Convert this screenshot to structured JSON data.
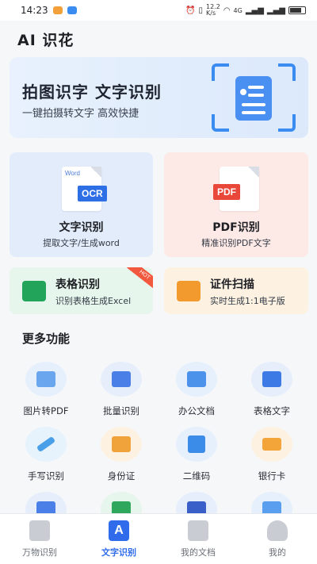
{
  "status_bar": {
    "time": "14:23",
    "net_speed": "12.2\nK/s",
    "signal": "4G",
    "battery": ""
  },
  "app": {
    "title": "AI 识花"
  },
  "banner": {
    "title": "拍图识字  文字识别",
    "subtitle": "一键拍摄转文字  高效快捷"
  },
  "cards": {
    "ocr": {
      "icon_word": "Word",
      "icon_tag": "OCR",
      "title": "文字识别",
      "subtitle": "提取文字/生成word"
    },
    "pdf": {
      "icon_tag": "PDF",
      "title": "PDF识别",
      "subtitle": "精准识别PDF文字"
    },
    "table": {
      "title": "表格识别",
      "subtitle": "识别表格生成Excel",
      "badge": "HOT"
    },
    "id": {
      "title": "证件扫描",
      "subtitle": "实时生成1:1电子版"
    }
  },
  "more": {
    "title": "更多功能",
    "items": [
      {
        "label": "图片转PDF",
        "icon": "image-pdf-icon",
        "color": "#6aa6ee"
      },
      {
        "label": "批量识别",
        "icon": "batch-scan-icon",
        "color": "#4a7fe8"
      },
      {
        "label": "办公文档",
        "icon": "office-doc-icon",
        "color": "#4d92ea"
      },
      {
        "label": "表格文字",
        "icon": "table-text-icon",
        "color": "#3d7ae6"
      },
      {
        "label": "手写识别",
        "icon": "pen-icon",
        "color": "#4aa0e8"
      },
      {
        "label": "身份证",
        "icon": "id-card-icon",
        "color": "#f0a33a"
      },
      {
        "label": "二维码",
        "icon": "qr-code-icon",
        "color": "#3b8be8"
      },
      {
        "label": "银行卡",
        "icon": "bank-card-icon",
        "color": "#f3a53a"
      }
    ]
  },
  "tabs": [
    {
      "label": "万物识别",
      "icon": "image-icon",
      "active": false
    },
    {
      "label": "文字识别",
      "icon": "text-a-icon",
      "active": true,
      "glyph": "A"
    },
    {
      "label": "我的文档",
      "icon": "document-icon",
      "active": false
    },
    {
      "label": "我的",
      "icon": "user-icon",
      "active": false
    }
  ],
  "colors": {
    "accent": "#2f6bea",
    "banner_bg": "#e3edfb",
    "ocr_card_bg": "#e3ecfb",
    "pdf_card_bg": "#fde9e6",
    "table_card_bg": "#e7f6ec",
    "id_card_bg": "#fdf2e2"
  }
}
